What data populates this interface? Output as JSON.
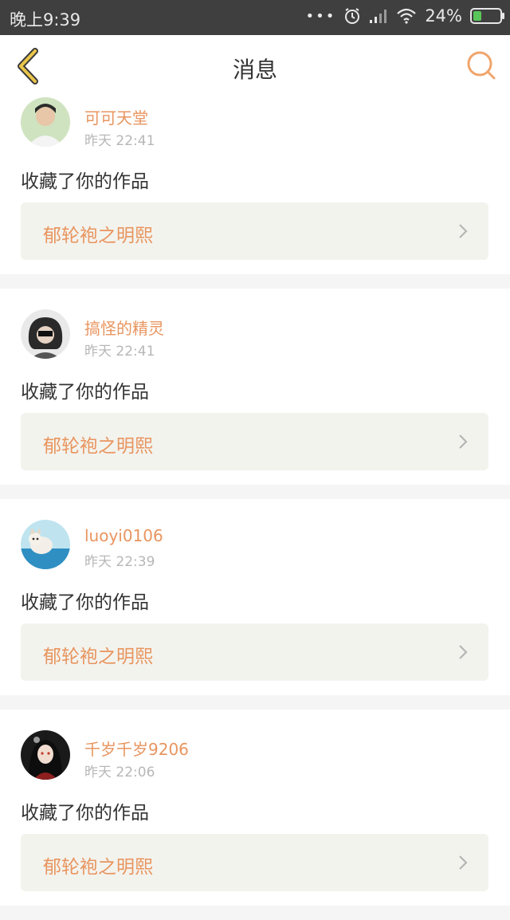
{
  "status_bar": {
    "time": "晚上9:39",
    "signal_dots": "•••",
    "battery_percent": "24%",
    "icons": [
      "alarm-icon",
      "signal-icon",
      "wifi-icon",
      "battery-icon"
    ]
  },
  "header": {
    "title": "消息",
    "back_icon": "chevron-left-icon",
    "search_icon": "search-icon"
  },
  "colors": {
    "accent": "#e8955f",
    "back_arrow": "#e9c54b",
    "status_bar_bg": "#3f3f3f",
    "work_bg": "#f3f3ee"
  },
  "messages": [
    {
      "username": "可可天堂",
      "time": "昨天 22:41",
      "action": "收藏了你的作品",
      "work_title": "郁轮袍之明熙"
    },
    {
      "username": "搞怪的精灵",
      "time": "昨天 22:41",
      "action": "收藏了你的作品",
      "work_title": "郁轮袍之明熙"
    },
    {
      "username": "luoyi0106",
      "time": "昨天 22:39",
      "action": "收藏了你的作品",
      "work_title": "郁轮袍之明熙"
    },
    {
      "username": "千岁千岁9206",
      "time": "昨天 22:06",
      "action": "收藏了你的作品",
      "work_title": "郁轮袍之明熙"
    }
  ]
}
